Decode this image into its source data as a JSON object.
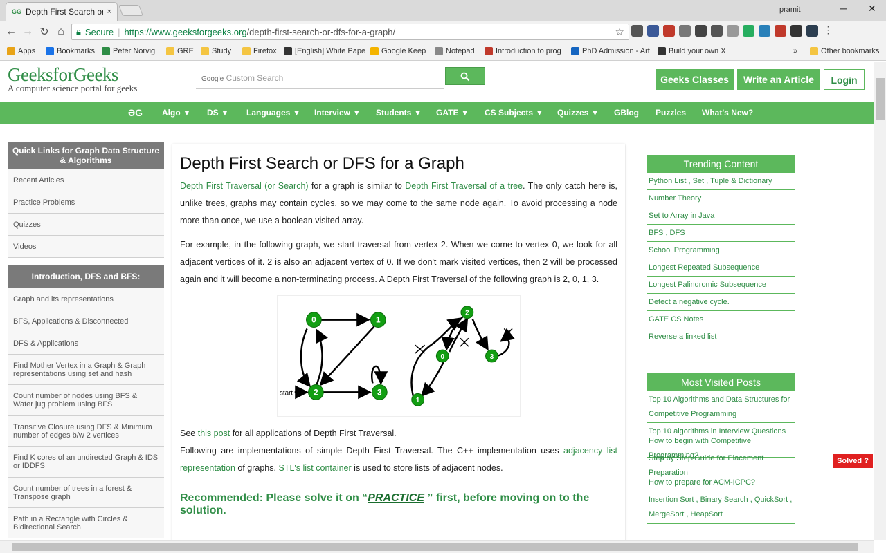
{
  "tab": {
    "title": "Depth First Search or DFS",
    "favicon": "GG",
    "close": "×"
  },
  "window": {
    "user": "pramit"
  },
  "address": {
    "secure_label": "Secure",
    "url_host": "https://www.geeksforgeeks.org",
    "url_path": "/depth-first-search-or-dfs-for-a-graph/"
  },
  "bookmarks": [
    {
      "label": "Apps",
      "color": "#e8a317"
    },
    {
      "label": "Bookmarks",
      "color": "#1a73e8"
    },
    {
      "label": "Peter Norvig",
      "color": "#2f8d46"
    },
    {
      "label": "GRE",
      "color": "#f4c542"
    },
    {
      "label": "Study",
      "color": "#f4c542"
    },
    {
      "label": "Firefox",
      "color": "#f4c542"
    },
    {
      "label": "[English] White Pape",
      "color": "#333333"
    },
    {
      "label": "Google Keep",
      "color": "#f4b400"
    },
    {
      "label": "Notepad",
      "color": "#888888"
    },
    {
      "label": "Introduction to prog",
      "color": "#c0392b"
    },
    {
      "label": "PhD Admission - Art",
      "color": "#1565c0"
    },
    {
      "label": "Build your own X",
      "color": "#333333"
    }
  ],
  "bookmarks_more": "»",
  "bookmarks_other": "Other bookmarks",
  "site": {
    "logo": "GeeksforGeeks",
    "tagline": "A computer science portal for geeks",
    "search_placeholder": "Custom Search",
    "search_brand": "Google",
    "btn_classes": "Geeks Classes",
    "btn_write": "Write an Article",
    "btn_login": "Login"
  },
  "menu": [
    "ƏG",
    "Algo ▼",
    "DS ▼",
    "Languages ▼",
    "Interview ▼",
    "Students ▼",
    "GATE ▼",
    "CS Subjects ▼",
    "Quizzes ▼",
    "GBlog",
    "Puzzles",
    "What's New?"
  ],
  "sidebar": {
    "head1": "Quick Links for Graph Data Structure & Algorithms",
    "items1": [
      "Recent Articles",
      "Practice Problems",
      "Quizzes",
      "Videos"
    ],
    "head2": "Introduction, DFS and BFS:",
    "items2": [
      "Graph and its representations",
      "BFS, Applications & Disconnected",
      "DFS & Applications",
      "Find Mother Vertex in a Graph & Graph representations using set and hash",
      "Count number of nodes using BFS & Water jug problem using BFS",
      "Transitive Closure using DFS & Minimum number of edges b/w 2 vertices",
      "Find K cores of an undirected Graph & IDS or IDDFS",
      "Count number of trees in a forest & Transpose graph",
      "Path in a Rectangle with Circles & Bidirectional Search"
    ]
  },
  "article": {
    "title": "Depth First Search or DFS for a Graph",
    "p1_link1": "Depth First Traversal (or Search)",
    "p1_mid": " for a graph is similar to ",
    "p1_link2": "Depth First Traversal of a tree",
    "p1_rest": ". The only catch here is, unlike trees, graphs may contain cycles, so we may come to the same node again. To avoid processing a node more than once, we use a boolean visited array.",
    "p2": "For example, in the following graph, we start traversal from vertex 2. When we come to vertex 0, we look for all adjacent vertices of it. 2 is also an adjacent vertex of 0. If we don't mark visited vertices, then 2 will be processed again and it will become a non-terminating process. A Depth First Traversal of the following graph is 2, 0, 1, 3.",
    "fig_start": "start",
    "fig_nodes": [
      "0",
      "1",
      "2",
      "3"
    ],
    "p3_pre": "See ",
    "p3_link": "this post",
    "p3_post": " for all applications of Depth First Traversal.",
    "p4_pre": "Following are implementations of simple Depth First Traversal. The C++ implementation uses ",
    "p4_link": "adjacency list representation",
    "p4_mid": " of graphs. ",
    "p4_link2": "STL's list container",
    "p4_post": " is used to store lists of adjacent nodes.",
    "reco_pre": "Recommended: Please solve it on “",
    "reco_link": "PRACTICE",
    "reco_post": " ” first, before moving on to the solution."
  },
  "trending": {
    "head": "Trending Content",
    "items": [
      "Python List , Set , Tuple & Dictionary",
      "Number Theory",
      "Set to Array in Java",
      "BFS , DFS",
      "School Programming",
      "Longest Repeated Subsequence",
      "Longest Palindromic Subsequence",
      "Detect a negative cycle.",
      "GATE CS Notes",
      "Reverse a linked list"
    ]
  },
  "visited": {
    "head": "Most Visited Posts",
    "items": [
      "Top 10 Algorithms and Data Structures for Competitive Programming",
      "Top 10 algorithms in Interview Questions",
      "How to begin with Competitive Programming?",
      "Step by Step Guide for Placement Preparation",
      "How to prepare for ACM-ICPC?",
      "Insertion Sort , Binary Search , QuickSort , MergeSort , HeapSort"
    ]
  },
  "solved": "Solved ?",
  "colors": {
    "brand": "#2f8d46",
    "menu": "#5cb85c",
    "solved": "#e02020"
  }
}
